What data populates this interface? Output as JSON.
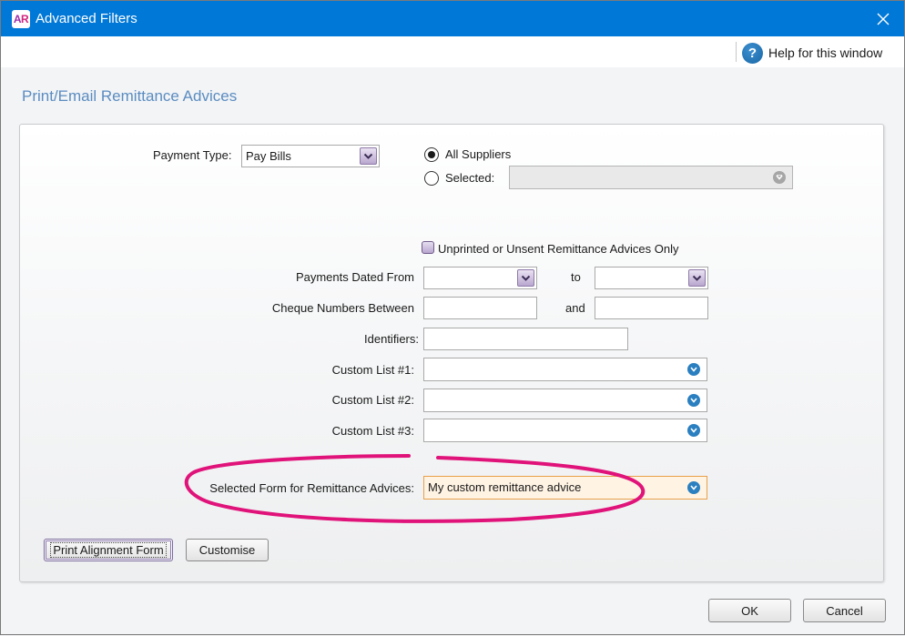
{
  "window": {
    "title": "Advanced Filters",
    "app_icon": {
      "letters": [
        "A",
        "R"
      ]
    },
    "close_icon": "close-icon"
  },
  "toolbar": {
    "help_label": "Help for this window",
    "help_icon": "question-circle-icon"
  },
  "section_title": "Print/Email Remittance Advices",
  "filters": {
    "payment_type": {
      "label": "Payment Type:",
      "value": "Pay Bills"
    },
    "suppliers": {
      "all_label": "All Suppliers",
      "selected_label": "Selected:",
      "selection": "all",
      "selected_value": ""
    },
    "unprinted_only": {
      "label": "Unprinted or Unsent Remittance Advices Only",
      "checked": false
    },
    "payments_dated": {
      "label": "Payments Dated From",
      "to_label": "to",
      "from_value": "",
      "to_value": ""
    },
    "cheque_numbers": {
      "label": "Cheque Numbers Between",
      "and_label": "and",
      "from_value": "",
      "to_value": ""
    },
    "identifiers": {
      "label": "Identifiers:",
      "value": ""
    },
    "custom_lists": [
      {
        "label": "Custom List #1:",
        "value": ""
      },
      {
        "label": "Custom List #2:",
        "value": ""
      },
      {
        "label": "Custom List #3:",
        "value": ""
      }
    ],
    "selected_form": {
      "label": "Selected Form for Remittance Advices:",
      "value": "My custom remittance advice"
    }
  },
  "buttons": {
    "print_alignment": "Print Alignment Form",
    "customise": "Customise",
    "ok": "OK",
    "cancel": "Cancel"
  },
  "colors": {
    "titlebar": "#0078d7",
    "section_title": "#5b8cc0",
    "annotation": "#e0137a",
    "highlight_field_bg": "#fff3e3",
    "highlight_field_border": "#e8a04a"
  }
}
